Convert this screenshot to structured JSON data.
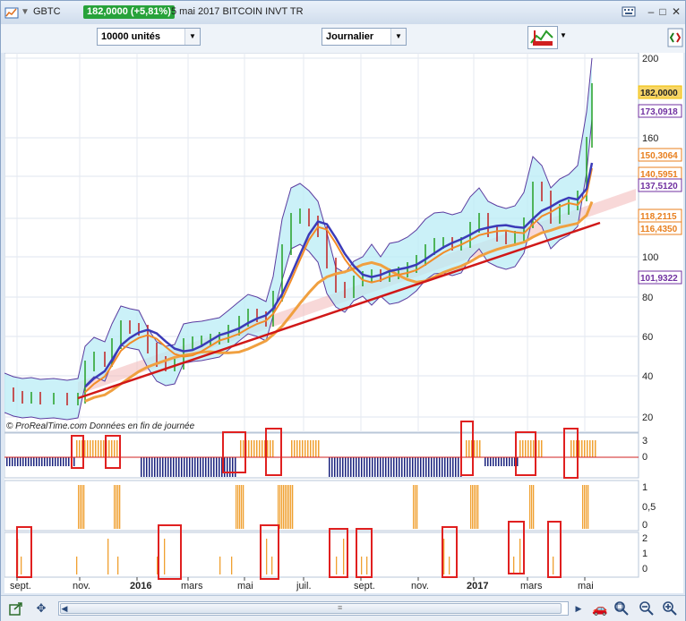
{
  "titlebar": {
    "symbol": "GBTC",
    "price_change": "182,0000 (+5,81%)",
    "subtitle": "5 mai 2017 BITCOIN INVT TR"
  },
  "toolbar": {
    "quantity": "10000 unités",
    "period": "Journalier"
  },
  "watermark": "© ProRealTime.com  Données en fin de journée",
  "price_axis": {
    "ticks": [
      "200",
      "160",
      "140",
      "120",
      "100",
      "80",
      "60",
      "40",
      "20"
    ],
    "labels": [
      {
        "text": "182,0000",
        "color": "#f0c000",
        "bg": "#f7d566"
      },
      {
        "text": "173,0918",
        "color": "#7030a0",
        "bg": "#ffffff"
      },
      {
        "text": "150,3064",
        "color": "#e87f1e",
        "bg": "#ffffff"
      },
      {
        "text": "140,5951",
        "color": "#e87f1e",
        "bg": "#ffffff"
      },
      {
        "text": "137,5120",
        "color": "#7030a0",
        "bg": "#ffffff"
      },
      {
        "text": "118,2115",
        "color": "#e87f1e",
        "bg": "#ffffff"
      },
      {
        "text": "116,4350",
        "color": "#e87f1e",
        "bg": "#ffffff"
      },
      {
        "text": "101,9322",
        "color": "#7030a0",
        "bg": "#ffffff"
      }
    ]
  },
  "panel1": {
    "ticks": [
      "3",
      "0"
    ]
  },
  "panel2": {
    "ticks": [
      "1",
      "0,5",
      "0"
    ]
  },
  "panel3": {
    "ticks": [
      "2",
      "1",
      "0"
    ]
  },
  "time_axis": [
    "sept.",
    "nov.",
    "2016",
    "mars",
    "mai",
    "juil.",
    "sept.",
    "nov.",
    "2017",
    "mars",
    "mai"
  ]
}
